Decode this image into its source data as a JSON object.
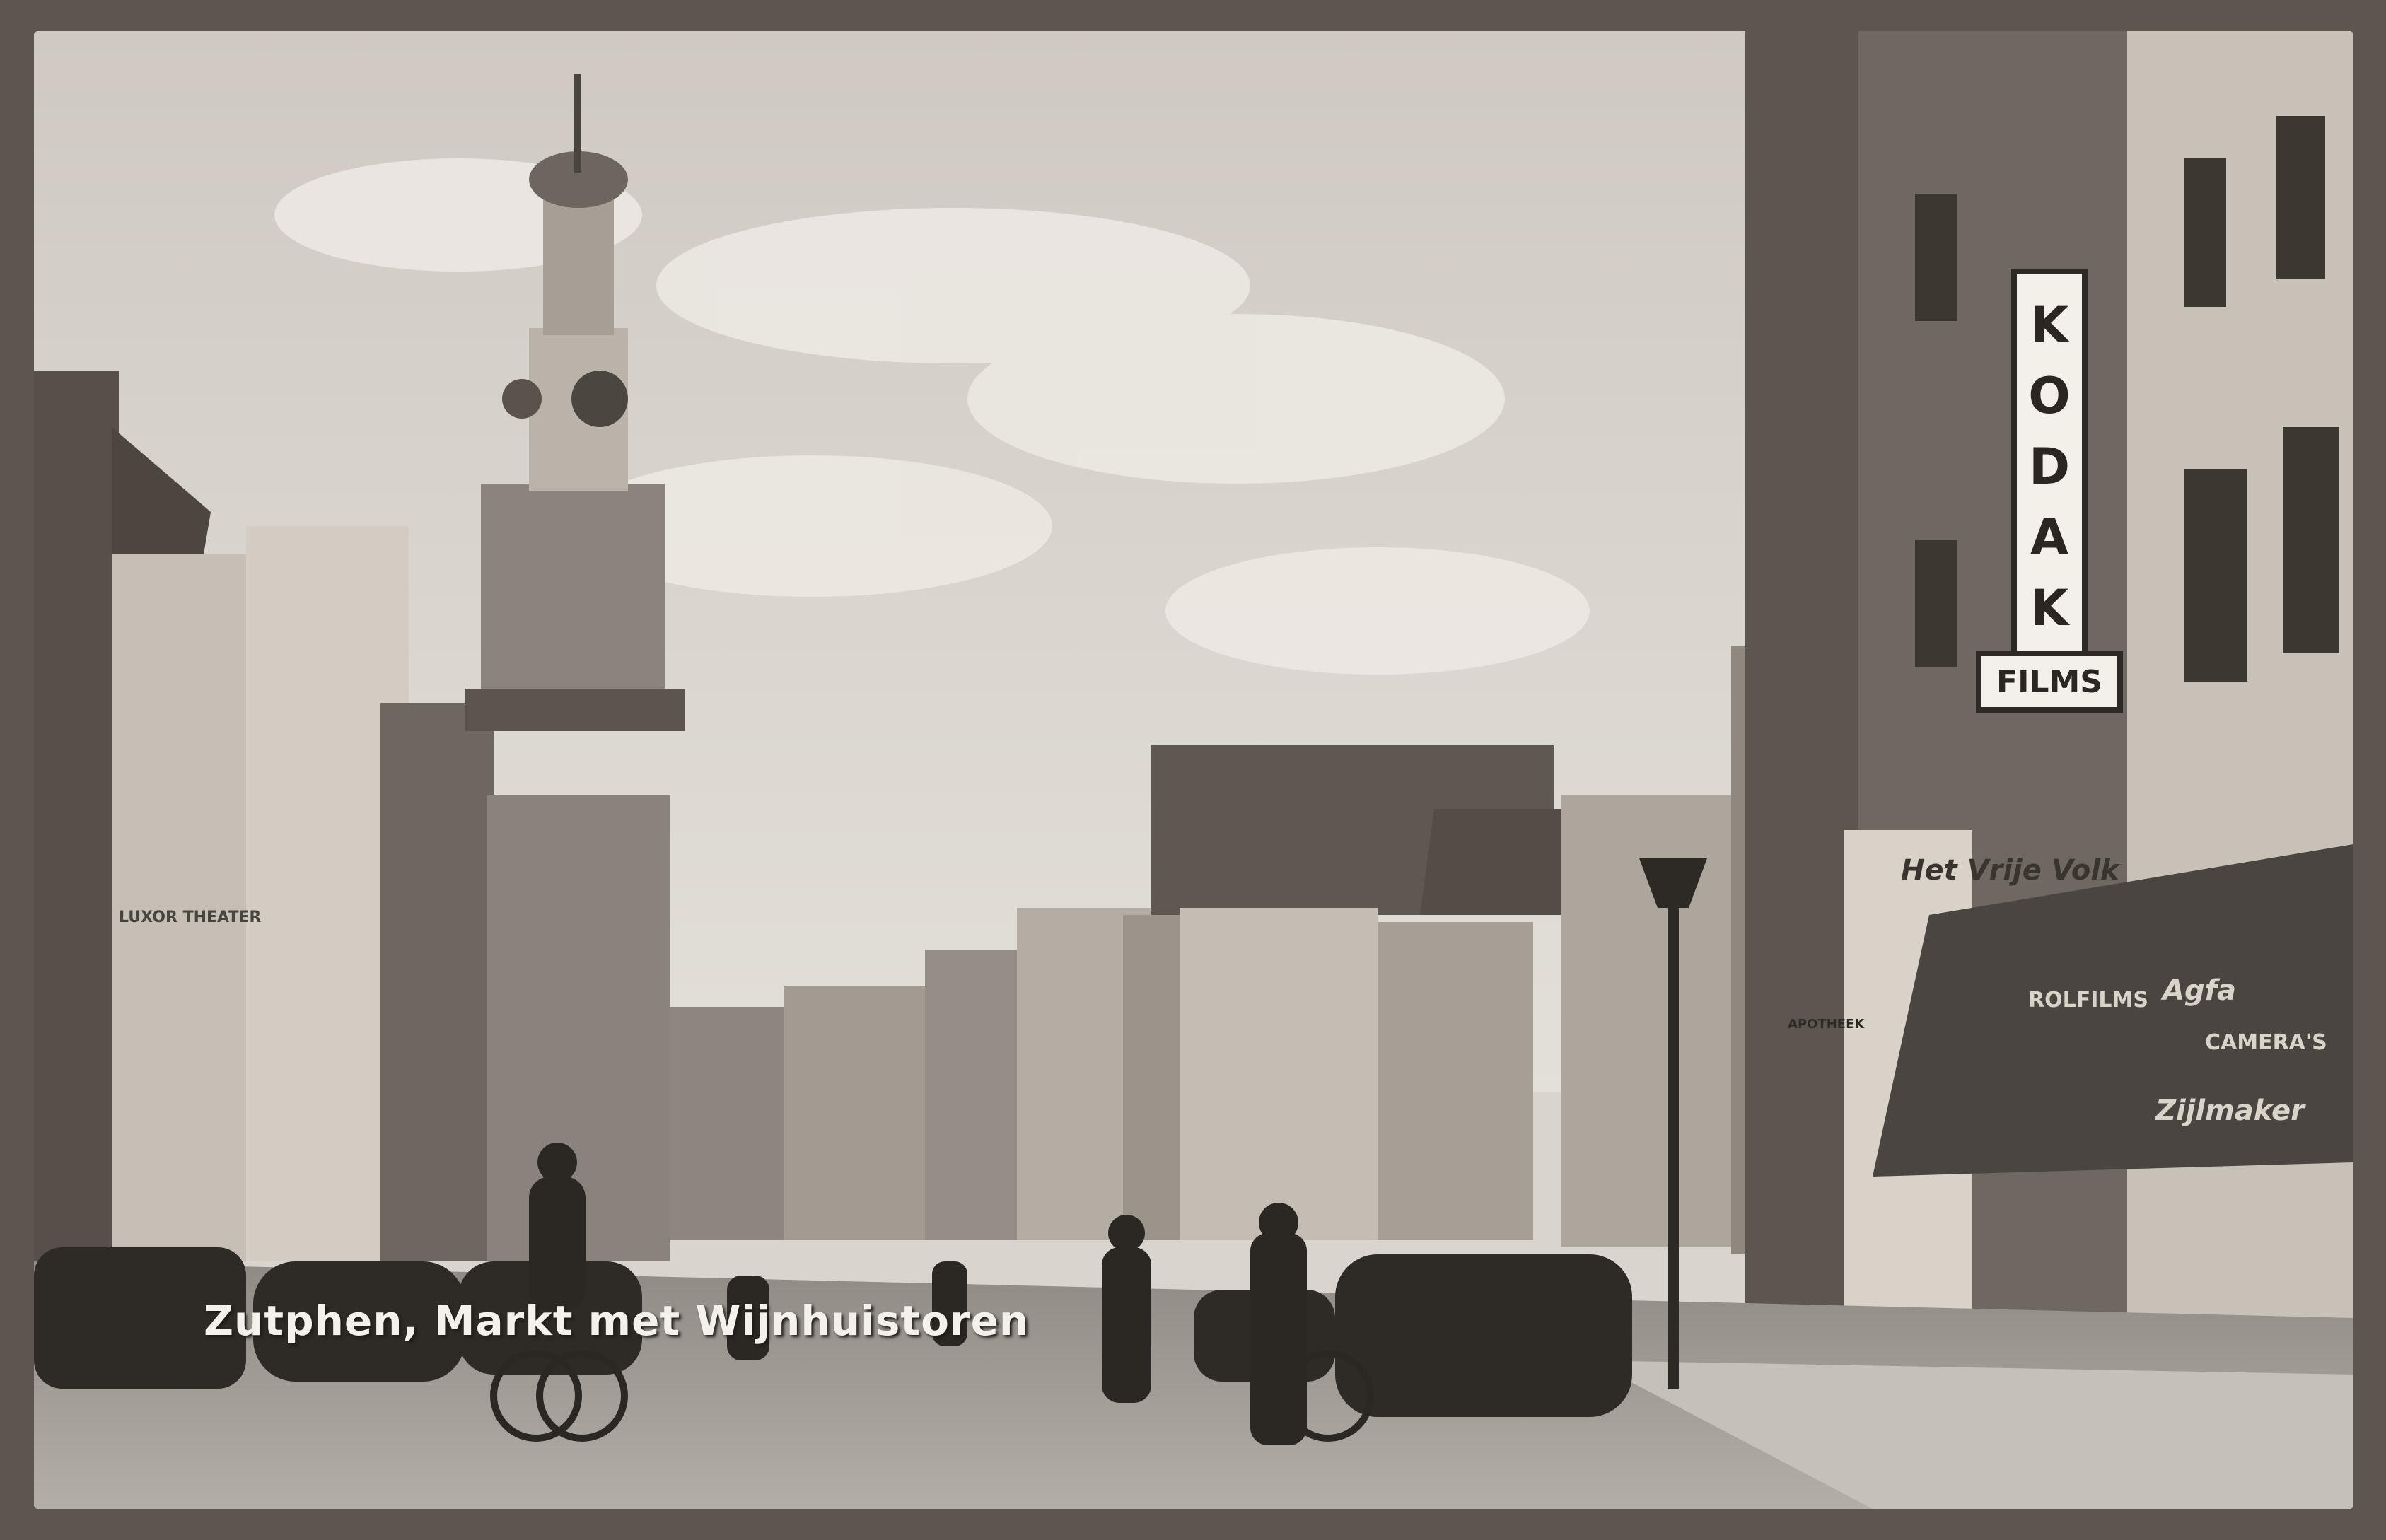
{
  "caption": "Zutphen, Markt met Wijnhuistoren",
  "signs": {
    "kodak_letters": [
      "K",
      "O",
      "D",
      "A",
      "K"
    ],
    "films": "FILMS",
    "shop_name": "Het Vrije Volk",
    "awning_line1": "ROLFILMS",
    "awning_line2": "CAMERA'S",
    "awning_brand": "Agfa",
    "awning_script": "Zijlmaker",
    "left_theater": "LUXOR THEATER",
    "apotheek": "APOTHEEK"
  },
  "colors": {
    "sky": "#dcd7d0",
    "cloud": "#eae6e0",
    "street": "#a8a39c",
    "building_dark": "#3f3a35",
    "building_mid": "#7b746c",
    "building_light": "#b9b2a9",
    "awning": "#4a4540",
    "frame": "#5e554f"
  }
}
